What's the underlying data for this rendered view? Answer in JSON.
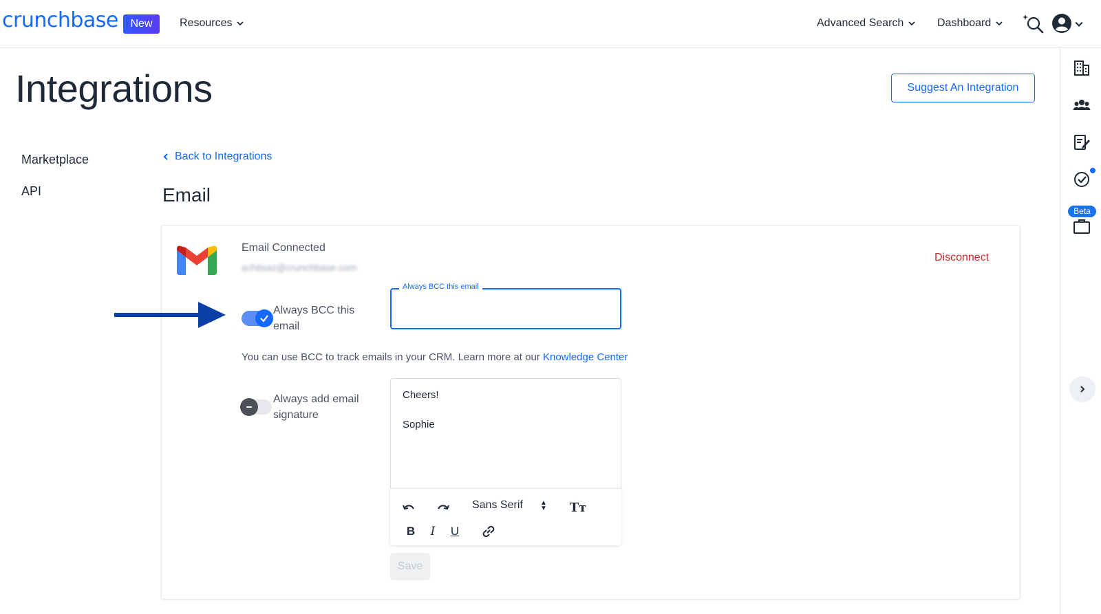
{
  "header": {
    "logo": "crunchbase",
    "new_badge": "New",
    "resources": "Resources",
    "advanced_search": "Advanced Search",
    "dashboard": "Dashboard"
  },
  "rail": {
    "beta_badge": "Beta"
  },
  "page": {
    "title": "Integrations",
    "suggest_button": "Suggest An Integration"
  },
  "sidebar": {
    "items": [
      {
        "label": "Marketplace"
      },
      {
        "label": "API"
      }
    ]
  },
  "main": {
    "back_link": "Back to Integrations",
    "section_title": "Email"
  },
  "card": {
    "connected_label": "Email Connected",
    "connected_email": "schitsaz@crunchbase.com",
    "disconnect": "Disconnect",
    "bcc_toggle_label": "Always BCC this email",
    "bcc_toggle_on": true,
    "bcc_field_legend": "Always BCC this email",
    "bcc_field_value": "",
    "help_text": "You can use BCC to track emails in your CRM. Learn more at our",
    "help_link": "Knowledge Center",
    "signature_toggle_label": "Always add email signature",
    "signature_toggle_on": false,
    "signature_lines": [
      "Cheers!",
      "Sophie"
    ],
    "font_select": "Sans Serif",
    "save_button": "Save"
  },
  "colors": {
    "brand": "#146aff",
    "danger": "#d0282c",
    "arrow": "#0b3fa8"
  }
}
